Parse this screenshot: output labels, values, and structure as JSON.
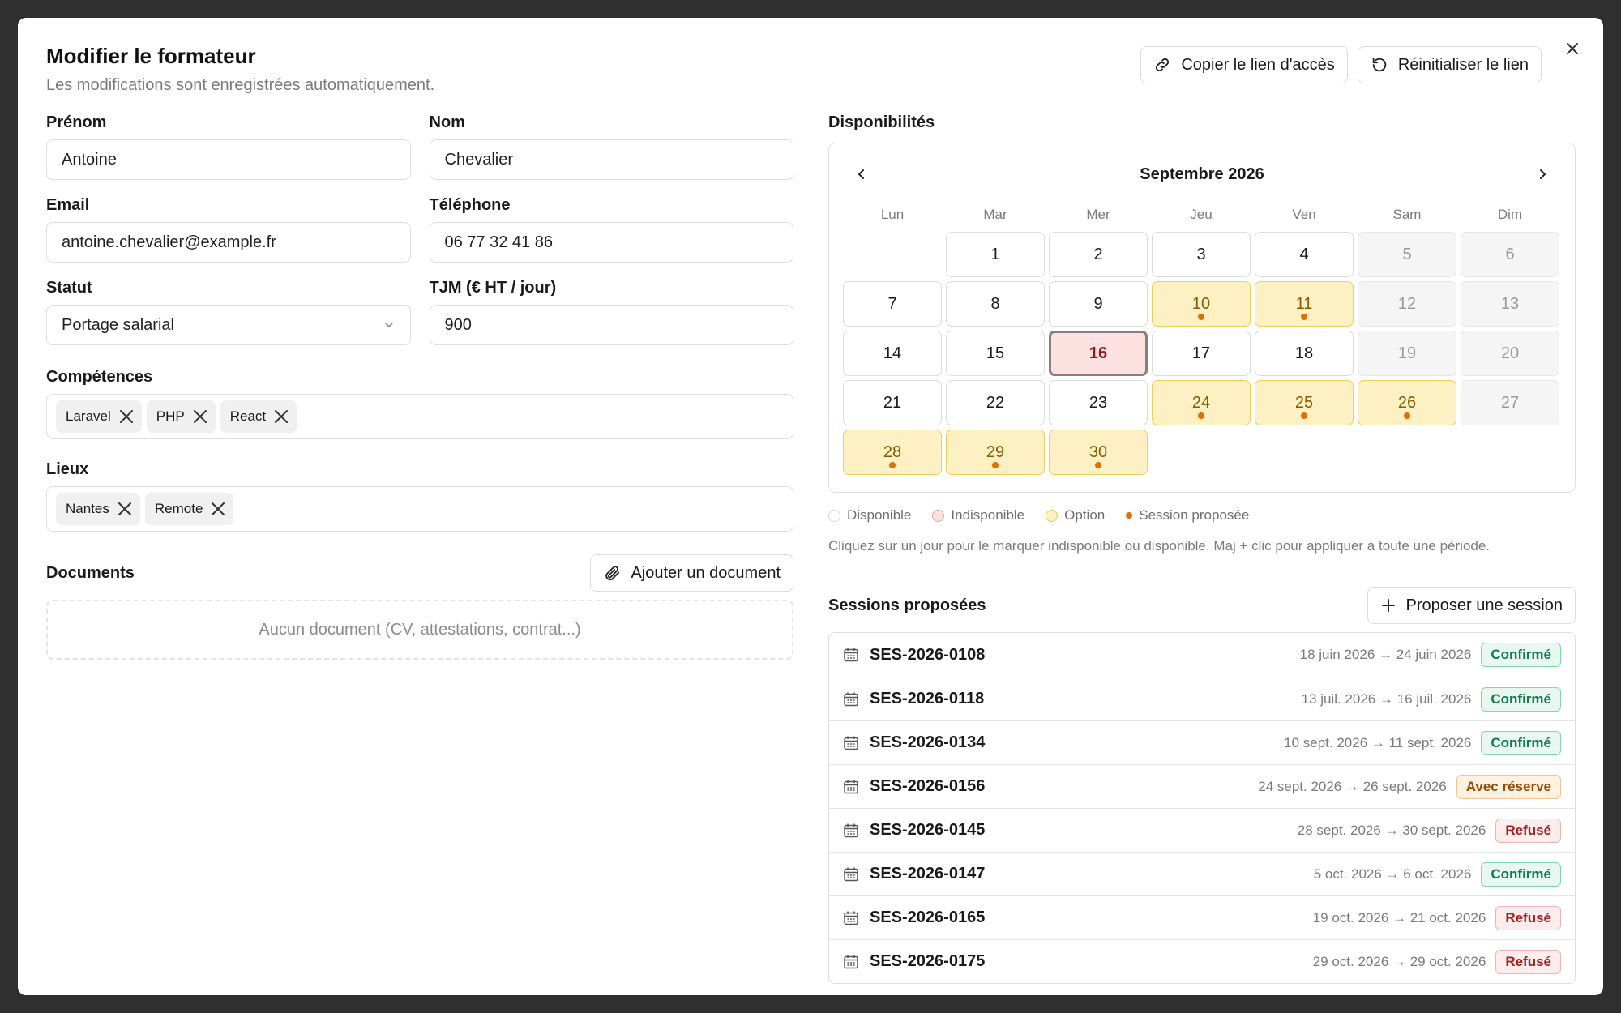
{
  "modal": {
    "title": "Modifier le formateur",
    "subtitle": "Les modifications sont enregistrées automatiquement.",
    "copy_link_label": "Copier le lien d'accès",
    "reset_link_label": "Réinitialiser le lien"
  },
  "form": {
    "prenom": {
      "label": "Prénom",
      "value": "Antoine"
    },
    "nom": {
      "label": "Nom",
      "value": "Chevalier"
    },
    "email": {
      "label": "Email",
      "value": "antoine.chevalier@example.fr"
    },
    "telephone": {
      "label": "Téléphone",
      "value": "06 77 32 41 86"
    },
    "statut": {
      "label": "Statut",
      "value": "Portage salarial"
    },
    "tjm": {
      "label": "TJM (€ HT / jour)",
      "value": "900"
    },
    "competences": {
      "label": "Compétences",
      "tags": [
        "Laravel",
        "PHP",
        "React"
      ]
    },
    "lieux": {
      "label": "Lieux",
      "tags": [
        "Nantes",
        "Remote"
      ]
    }
  },
  "documents": {
    "label": "Documents",
    "add_label": "Ajouter un document",
    "empty_text": "Aucun document (CV, attestations, contrat...)"
  },
  "availability": {
    "label": "Disponibilités",
    "month": "Septembre 2026",
    "weekdays": [
      "Lun",
      "Mar",
      "Mer",
      "Jeu",
      "Ven",
      "Sam",
      "Dim"
    ],
    "days": [
      {
        "n": "",
        "state": "empty"
      },
      {
        "n": "1",
        "state": "available"
      },
      {
        "n": "2",
        "state": "available"
      },
      {
        "n": "3",
        "state": "available"
      },
      {
        "n": "4",
        "state": "available"
      },
      {
        "n": "5",
        "state": "weekend"
      },
      {
        "n": "6",
        "state": "weekend"
      },
      {
        "n": "7",
        "state": "available"
      },
      {
        "n": "8",
        "state": "available"
      },
      {
        "n": "9",
        "state": "available"
      },
      {
        "n": "10",
        "state": "option",
        "session": true
      },
      {
        "n": "11",
        "state": "option",
        "session": true
      },
      {
        "n": "12",
        "state": "weekend"
      },
      {
        "n": "13",
        "state": "weekend"
      },
      {
        "n": "14",
        "state": "available"
      },
      {
        "n": "15",
        "state": "available"
      },
      {
        "n": "16",
        "state": "unavailable"
      },
      {
        "n": "17",
        "state": "available"
      },
      {
        "n": "18",
        "state": "available"
      },
      {
        "n": "19",
        "state": "weekend"
      },
      {
        "n": "20",
        "state": "weekend"
      },
      {
        "n": "21",
        "state": "available"
      },
      {
        "n": "22",
        "state": "available"
      },
      {
        "n": "23",
        "state": "available"
      },
      {
        "n": "24",
        "state": "option",
        "session": true
      },
      {
        "n": "25",
        "state": "option",
        "session": true
      },
      {
        "n": "26",
        "state": "option",
        "session": true
      },
      {
        "n": "27",
        "state": "weekend"
      },
      {
        "n": "28",
        "state": "option",
        "session": true
      },
      {
        "n": "29",
        "state": "option",
        "session": true
      },
      {
        "n": "30",
        "state": "option",
        "session": true
      }
    ],
    "legend": {
      "disponible": "Disponible",
      "indisponible": "Indisponible",
      "option": "Option",
      "session": "Session proposée"
    },
    "hint": "Cliquez sur un jour pour le marquer indisponible ou disponible. Maj + clic pour appliquer à toute une période."
  },
  "sessions": {
    "label": "Sessions proposées",
    "add_label": "Proposer une session",
    "rows": [
      {
        "code": "SES-2026-0108",
        "dates": "18 juin 2026 → 24 juin 2026",
        "status": "Confirmé",
        "kind": "confirme"
      },
      {
        "code": "SES-2026-0118",
        "dates": "13 juil. 2026 → 16 juil. 2026",
        "status": "Confirmé",
        "kind": "confirme"
      },
      {
        "code": "SES-2026-0134",
        "dates": "10 sept. 2026 → 11 sept. 2026",
        "status": "Confirmé",
        "kind": "confirme"
      },
      {
        "code": "SES-2026-0156",
        "dates": "24 sept. 2026 → 26 sept. 2026",
        "status": "Avec réserve",
        "kind": "reserve"
      },
      {
        "code": "SES-2026-0145",
        "dates": "28 sept. 2026 → 30 sept. 2026",
        "status": "Refusé",
        "kind": "refuse"
      },
      {
        "code": "SES-2026-0147",
        "dates": "5 oct. 2026 → 6 oct. 2026",
        "status": "Confirmé",
        "kind": "confirme"
      },
      {
        "code": "SES-2026-0165",
        "dates": "19 oct. 2026 → 21 oct. 2026",
        "status": "Refusé",
        "kind": "refuse"
      },
      {
        "code": "SES-2026-0175",
        "dates": "29 oct. 2026 → 29 oct. 2026",
        "status": "Refusé",
        "kind": "refuse"
      }
    ]
  },
  "colors": {
    "option_bg": "#fdf0c2",
    "unavailable_bg": "#fde0e0",
    "session_dot": "#e07000",
    "confirmed": "#127a50",
    "refused": "#a51f1f",
    "reserve": "#9a4a00"
  }
}
